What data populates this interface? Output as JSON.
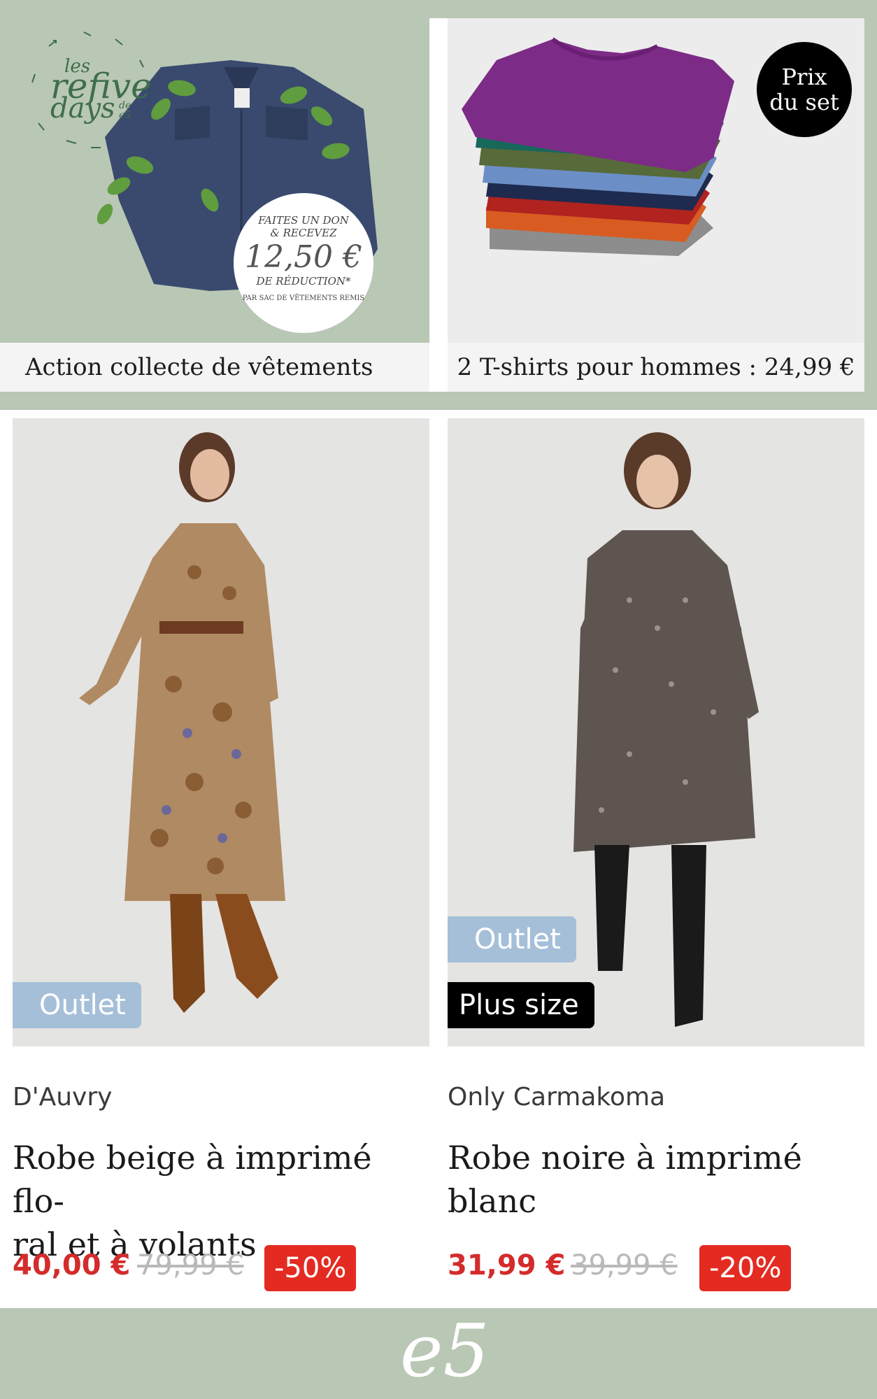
{
  "promo_left": {
    "logo_line1": "les",
    "logo_line2": "refive",
    "logo_line3": "days",
    "logo_small": "de e5",
    "badge_line1": "FAITES UN DON",
    "badge_line2": "& RECEVEZ",
    "badge_amount": "12,50 €",
    "badge_line3": "DE RÉDUCTION*",
    "badge_line4": "PAR SAC DE VÊTEMENTS REMIS",
    "caption": "Action collecte de vêtements"
  },
  "promo_right": {
    "badge_line1": "Prix",
    "badge_line2": "du set",
    "caption": "2 T-shirts pour hommes : 24,99 €"
  },
  "products": [
    {
      "tags": [
        "Outlet"
      ],
      "brand": "D'Auvry",
      "title_line1": "Robe beige à imprimé flo-",
      "title_line2": "ral et à volants",
      "price": "40,00 €",
      "old_price": "79,99 €",
      "discount": "-50%"
    },
    {
      "tags": [
        "Outlet",
        "Plus size"
      ],
      "brand": "Only Carmakoma",
      "title_line1": "Robe noire à imprimé",
      "title_line2": "blanc",
      "price": "31,99 €",
      "old_price": "39,99 €",
      "discount": "-20%"
    }
  ],
  "footer": {
    "logo": "e5"
  },
  "colors": {
    "frame_green": "#b9c7b5",
    "outlet_blue": "#a5bfd9",
    "sale_red": "#e32b22"
  }
}
